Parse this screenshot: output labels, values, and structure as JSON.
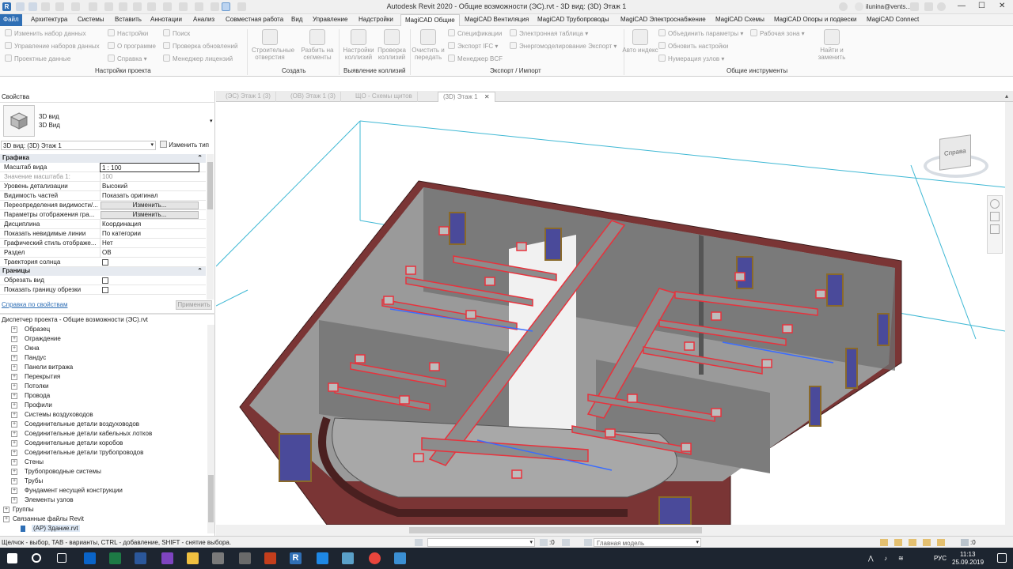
{
  "window": {
    "title": "Autodesk Revit 2020 - Общие возможности (ЭС).rvt - 3D вид: (3D) Этаж 1",
    "user": "ilunina@vents...",
    "minimize": "—",
    "maximize": "☐",
    "close": "✕"
  },
  "menu": {
    "file": "Файл",
    "tabs": [
      "Архитектура",
      "Системы",
      "Вставить",
      "Аннотации",
      "Анализ",
      "Совместная работа",
      "Вид",
      "Управление",
      "Надстройки",
      "MagiCAD Вентиляция",
      "MagiCAD Трубопроводы",
      "MagiCAD Электроснабжение",
      "MagiCAD Схемы",
      "MagiCAD Опоры и подвески",
      "MagiCAD Connect"
    ],
    "active_tab": "MagiCAD Общие"
  },
  "ribbon": {
    "project_settings": {
      "items": [
        "Изменить набор данных",
        "Управление наборов данных",
        "Проектные данные",
        "Настройки",
        "О программе",
        "Справка",
        "Поиск",
        "Проверка обновлений",
        "Менеджер лицензий"
      ],
      "label": "Настройки проекта"
    },
    "create": {
      "items": [
        "Строительные отверстия",
        "Разбить на сегменты"
      ],
      "label": "Создать"
    },
    "collisions": {
      "items": [
        "Настройки коллизий",
        "Проверка коллизий"
      ],
      "label": "Выявление коллизий"
    },
    "export_import": {
      "big": "Очистить и передать",
      "items": [
        "Спецификации",
        "Экспорт IFC",
        "Менеджер BCF",
        "Электронная таблица",
        "Энергомоделирование Экспорт"
      ],
      "label": "Экспорт / Импорт"
    },
    "common_tools": {
      "big_auto": "Авто индекс",
      "items": [
        "Объединить параметры",
        "Рабочая зона",
        "Обновить настройки",
        "Нумерация узлов"
      ],
      "big_find": "Найти и заменить",
      "label": "Общие инструменты"
    }
  },
  "properties": {
    "header": "Свойства",
    "type_line1": "3D вид",
    "type_line2": "3D Вид",
    "selector": "3D вид: (3D) Этаж 1",
    "edit_type": "Изменить тип",
    "sections": {
      "graphics": "Графика",
      "bounds": "Границы"
    },
    "rows": [
      {
        "k": "Масштаб вида",
        "v": "1 : 100"
      },
      {
        "k": "Значение масштаба    1:",
        "v": "100"
      },
      {
        "k": "Уровень детализации",
        "v": "Высокий"
      },
      {
        "k": "Видимость частей",
        "v": "Показать оригинал"
      },
      {
        "k": "Переопределения видимости/...",
        "v": "Изменить..."
      },
      {
        "k": "Параметры отображения гра...",
        "v": "Изменить..."
      },
      {
        "k": "Дисциплина",
        "v": "Координация"
      },
      {
        "k": "Показать невидимые линии",
        "v": "По категории"
      },
      {
        "k": "Графический стиль отображе...",
        "v": "Нет"
      },
      {
        "k": "Раздел",
        "v": "ОВ"
      },
      {
        "k": "Траектория солнца",
        "v": ""
      },
      {
        "k": "Обрезать вид",
        "v": ""
      },
      {
        "k": "Показать границу обрезки",
        "v": ""
      }
    ],
    "help_link": "Справка по свойствам",
    "apply": "Применить"
  },
  "browser": {
    "header": "Диспетчер проекта - Общие возможности (ЭС).rvt",
    "items": [
      "Образец",
      "Ограждение",
      "Окна",
      "Пандус",
      "Панели витража",
      "Перекрытия",
      "Потолки",
      "Провода",
      "Профили",
      "Системы воздуховодов",
      "Соединительные детали воздуховодов",
      "Соединительные детали кабельных лотков",
      "Соединительные детали коробов",
      "Соединительные детали трубопроводов",
      "Стены",
      "Трубопроводные системы",
      "Трубы",
      "Фундамент несущей конструкции",
      "Элементы узлов"
    ],
    "groups": "Группы",
    "linked": "Связанные файлы Revit",
    "linked_child": "(АР) Здание.rvt"
  },
  "view_tabs": [
    "(ЭС) Этаж 1 (3)",
    "(ОВ) Этаж 1 (3)",
    "ЩО - Схемы щитов",
    "(3D) Этаж 1"
  ],
  "viewcube": {
    "face": "Справа"
  },
  "status": {
    "hint": "Щелчок - выбор, TAB - варианты, CTRL - добавление, SHIFT - снятие выбора.",
    "zero1": ":0",
    "zero2": ":0",
    "model": "Главная модель",
    "filter": ":0"
  },
  "taskbar": {
    "lang": "РУС",
    "time": "11:13",
    "date": "25.09.2019"
  },
  "colors": {
    "accent": "#2f6fb5",
    "duct": "#e8323c",
    "brick": "#7a3535",
    "taskbar": "#1d2530"
  }
}
